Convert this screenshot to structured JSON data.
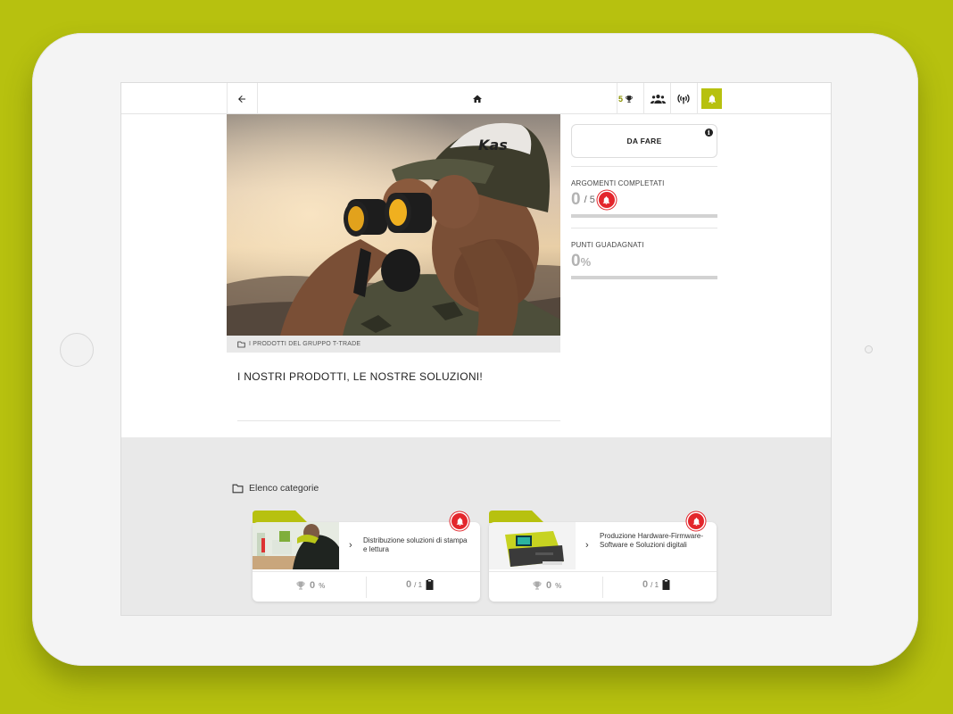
{
  "colors": {
    "accent": "#b7c10f",
    "alert": "#e3262c",
    "muted": "#b3b3b3"
  },
  "topbar": {
    "back_icon": "arrow-left-icon",
    "home_icon": "home-icon",
    "trophy_count": "5",
    "trophy_icon": "trophy-icon",
    "team_icon": "team-icon",
    "signal_icon": "broadcast-icon",
    "bell_icon": "bell-icon"
  },
  "hero": {
    "caption": "I PRODOTTI DEL GRUPPO T-TRADE",
    "caption_icon": "folder-icon",
    "cap_text": "Kas",
    "title": "I NOSTRI PRODOTTI, LE NOSTRE SOLUZIONI!"
  },
  "panel": {
    "todo_label": "DA FARE",
    "info_icon_text": "i",
    "topics_label": "ARGOMENTI COMPLETATI",
    "topics_done": "0",
    "topics_total": "/ 5",
    "topics_progress": 0,
    "points_label": "PUNTI GUADAGNATI",
    "points_value": "0",
    "points_unit": "%",
    "points_progress": 0
  },
  "categories": {
    "heading": "Elenco categorie",
    "heading_icon": "folder-icon",
    "items": [
      {
        "title": "Distribuzione soluzioni di stampa e lettura",
        "pct": "0",
        "pct_unit": "%",
        "done": "0",
        "total": "/ 1"
      },
      {
        "title": "Produzione Hardware-Firmware-Software e Soluzioni digitali",
        "pct": "0",
        "pct_unit": "%",
        "done": "0",
        "total": "/ 1"
      }
    ]
  }
}
